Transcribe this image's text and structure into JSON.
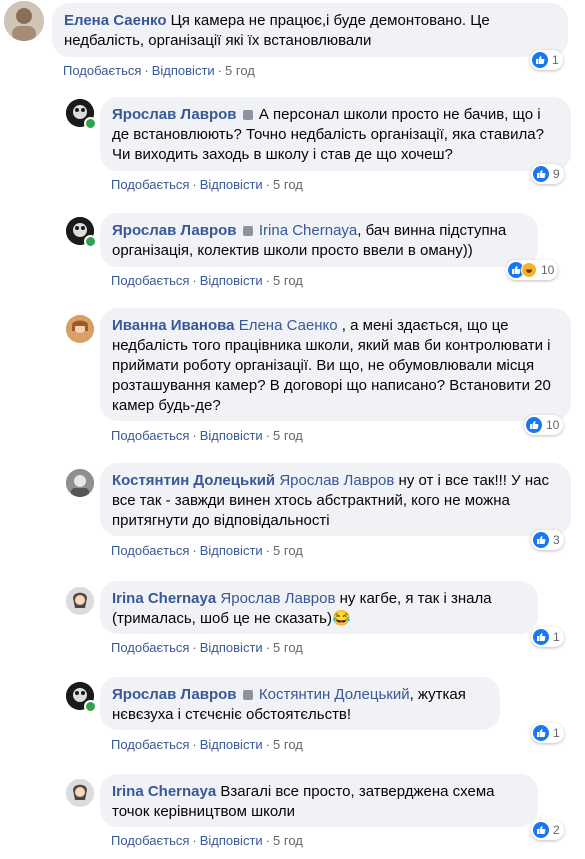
{
  "actions": {
    "like": "Подобається",
    "reply": "Відповісти",
    "sep": "·"
  },
  "comments": [
    {
      "author": "Елена Саенко",
      "mention": "",
      "text": "Ця камера не працює,і буде демонтовано. Це недбалість, організації які їх встановлювали",
      "time": "5 год",
      "reactions": "1"
    },
    {
      "author": "Ярослав Лавров",
      "mention": "",
      "text": "А персонал школи просто не бачив, що і де встановлюють? Точно недбалість організації, яка ставила? Чи виходить заходь в школу і став де що хочеш?",
      "time": "5 год",
      "reactions": "9"
    },
    {
      "author": "Ярослав Лавров",
      "mention": "Irina Chernaya",
      "text": ", бач винна підступна організація, колектив школи просто ввели в оману))",
      "time": "5 год",
      "reactions": "10"
    },
    {
      "author": "Иванна Иванова",
      "mention": "Елена Саенко",
      "text": " , а мені здається, що це недбалість того працівника школи, який мав би контролювати і приймати роботу організації. Ви що, не обумовлювали місця розташування камер? В договорі що написано? Встановити 20 камер будь-де?",
      "time": "5 год",
      "reactions": "10"
    },
    {
      "author": "Костянтин Долецький",
      "mention": "Ярослав Лавров",
      "text": " ну от і все так!!! У нас все так - завжди винен хтось абстрактний, кого не можна притягнути до відповідальності",
      "time": "5 год",
      "reactions": "3"
    },
    {
      "author": "Irina Chernaya",
      "mention": "Ярослав Лавров",
      "text": " ну кагбе, я так і знала (трималась, шоб це не сказать)",
      "emoji": "😂",
      "time": "5 год",
      "reactions": "1"
    },
    {
      "author": "Ярослав Лавров",
      "mention": "Костянтин Долецький",
      "text": ", жуткая нєвєзуха і стєчєніє обстоятєльств!",
      "time": "5 год",
      "reactions": "1"
    },
    {
      "author": "Irina Chernaya",
      "mention": "",
      "text": "Взагалі все просто, затверджена схема точок керівництвом школи",
      "time": "5 год",
      "reactions": "2"
    }
  ],
  "colors": {
    "link": "#385898",
    "bubble": "#f0f2f5",
    "like": "#1877f2",
    "meta": "#65676b"
  },
  "icons": {
    "like": "thumbs-up-icon",
    "haha": "laughing-face-icon",
    "badge": "shield-badge-icon"
  }
}
